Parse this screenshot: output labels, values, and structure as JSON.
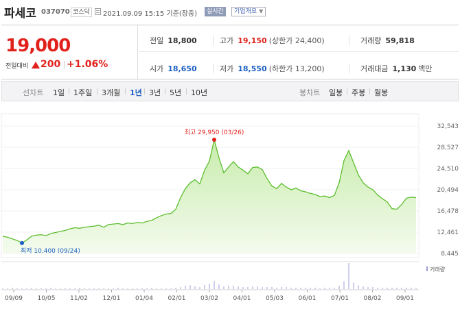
{
  "header": {
    "stock_name": "파세코",
    "stock_code": "037070",
    "market": "코스닥",
    "datetime": "2021.09.09 15:15  기준(장중)",
    "realtime_badge": "실시간",
    "company_menu": "기업개요"
  },
  "summary": {
    "price": "19,000",
    "change_label": "전일대비",
    "change": "200",
    "change_rate": "+1.06%",
    "prev_close_label": "전일",
    "prev_close": "18,800",
    "high_label": "고가",
    "high": "19,150",
    "upper_limit": "(상한가 24,400)",
    "volume_label": "거래량",
    "volume": "59,818",
    "open_label": "시가",
    "open": "18,650",
    "low_label": "저가",
    "low": "18,550",
    "lower_limit": "(하한가 13,200)",
    "amount_label": "거래대금",
    "amount": "1,130",
    "amount_unit": "백만"
  },
  "periods": {
    "line_label": "선차트",
    "line_items": [
      "1일",
      "1주일",
      "3개월",
      "1년",
      "3년",
      "5년",
      "10년"
    ],
    "selected": "1년",
    "candle_label": "봉차트",
    "candle_items": [
      "일봉",
      "주봉",
      "월봉"
    ]
  },
  "chart_data": {
    "type": "area",
    "y_ticks": [
      "32,543",
      "28,527",
      "24,510",
      "20,494",
      "16,478",
      "12,461",
      "8,445"
    ],
    "ylim": [
      8445,
      32543
    ],
    "x_ticks": [
      "09/09",
      "10/05",
      "11/02",
      "12/01",
      "01/04",
      "02/01",
      "03/02",
      "04/01",
      "05/03",
      "06/01",
      "07/01",
      "08/02",
      "09/01"
    ],
    "max_label": "최고 29,950 (03/26)",
    "min_label": "최저 10,400 (09/24)",
    "volume_legend": "거래량",
    "colors": {
      "line": "#5cbd2d",
      "fill_top": "#c8ecac",
      "fill_bottom": "#f4fbee",
      "max": "#e1211b",
      "min": "#1d5fc2",
      "volume": "#9b9bd8"
    },
    "series": [
      {
        "values": [
          11700,
          11500,
          11200,
          10900,
          10400,
          11000,
          11700,
          11900,
          12000,
          11800,
          12200,
          12400,
          12600,
          12800,
          13100,
          13300,
          13200,
          13400,
          13500,
          13600,
          13800,
          13400,
          13900,
          14000,
          14100,
          13900,
          14200,
          14100,
          14300,
          14200,
          14500,
          14700,
          15200,
          15600,
          15900,
          16000,
          16800,
          19000,
          20700,
          21800,
          22400,
          21600,
          24200,
          25900,
          29950,
          26500,
          23700,
          24800,
          25800,
          24800,
          24200,
          23500,
          24700,
          24800,
          24300,
          22600,
          21200,
          20700,
          21700,
          21000,
          20500,
          20800,
          20300,
          20100,
          19800,
          19600,
          19200,
          19300,
          19000,
          19400,
          21800,
          26000,
          27900,
          25600,
          23300,
          21800,
          21000,
          20500,
          19500,
          18800,
          18200,
          16900,
          16800,
          17700,
          18900,
          19100,
          19000
        ]
      }
    ],
    "volume": [
      1,
      1,
      2,
      1,
      1,
      1,
      2,
      1,
      1,
      1,
      2,
      1,
      1,
      1,
      1,
      1,
      2,
      1,
      1,
      1,
      1,
      1,
      1,
      1,
      2,
      1,
      1,
      1,
      1,
      1,
      1,
      2,
      1,
      1,
      1,
      1,
      2,
      3,
      5,
      6,
      4,
      3,
      6,
      8,
      12,
      7,
      4,
      5,
      5,
      4,
      3,
      3,
      4,
      4,
      3,
      3,
      3,
      2,
      3,
      3,
      2,
      2,
      2,
      2,
      2,
      2,
      1,
      2,
      2,
      2,
      5,
      12,
      40,
      10,
      6,
      4,
      3,
      3,
      2,
      2,
      2,
      2,
      2,
      2,
      2,
      2,
      2
    ]
  }
}
